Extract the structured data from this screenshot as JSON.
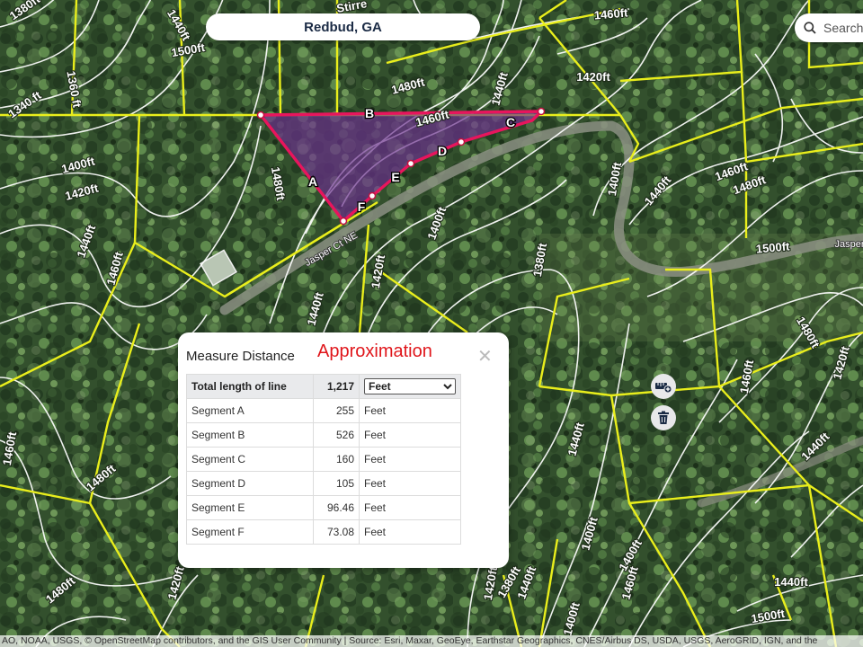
{
  "header": {
    "title": "Redbud, GA"
  },
  "search": {
    "placeholder": "Search a"
  },
  "map": {
    "contour_labels": [
      "1380ft",
      "1440ft",
      "1500ft",
      "Stirre",
      "1460ft",
      "1340 ft",
      "1360 ft",
      "1480ft",
      "1440ft",
      "1420ft",
      "1460ft",
      "1400ft",
      "1420ft",
      "1480ft",
      "1440ft",
      "1460ft",
      "1400ft",
      "1440ft",
      "1460ft",
      "1480ft",
      "1500ft",
      "1400ft",
      "1380ft",
      "1420ft",
      "1440ft",
      "1460ft",
      "1480ft",
      "1420ft",
      "1440ft",
      "1400ft",
      "1400ft",
      "1460ft",
      "1480ft",
      "1420ft",
      "1440ft",
      "1380ft",
      "1460ft",
      "1440ft",
      "1500ft",
      "1480ft",
      "1400ft",
      "1420ft",
      "1440ft"
    ],
    "road_labels": [
      "Jasper Ct NE",
      "Jasper"
    ],
    "segment_letters": [
      "A",
      "B",
      "C",
      "D",
      "E",
      "F"
    ],
    "colors": {
      "measure": "#e8155d",
      "fill": "#6b2f8f",
      "parcel": "#e9ee1c",
      "contour": "#ffffff"
    }
  },
  "measure_panel": {
    "title": "Measure Distance",
    "annotation": "Approximation",
    "close_icon": "close-icon",
    "total": {
      "label": "Total length of line",
      "value": "1,217",
      "unit": "Feet"
    },
    "unit_options": [
      "Feet"
    ],
    "segments": [
      {
        "label": "Segment A",
        "value": "255",
        "unit": "Feet"
      },
      {
        "label": "Segment B",
        "value": "526",
        "unit": "Feet"
      },
      {
        "label": "Segment C",
        "value": "160",
        "unit": "Feet"
      },
      {
        "label": "Segment D",
        "value": "105",
        "unit": "Feet"
      },
      {
        "label": "Segment E",
        "value": "96.46",
        "unit": "Feet"
      },
      {
        "label": "Segment F",
        "value": "73.08",
        "unit": "Feet"
      }
    ],
    "tools": [
      "add-measure-icon",
      "trash-icon"
    ]
  },
  "attribution": "AO, NOAA, USGS, © OpenStreetMap contributors, and the GIS User Community | Source: Esri, Maxar, GeoEye, Earthstar Geographics, CNES/Airbus DS, USDA, USGS, AeroGRID, IGN, and the"
}
